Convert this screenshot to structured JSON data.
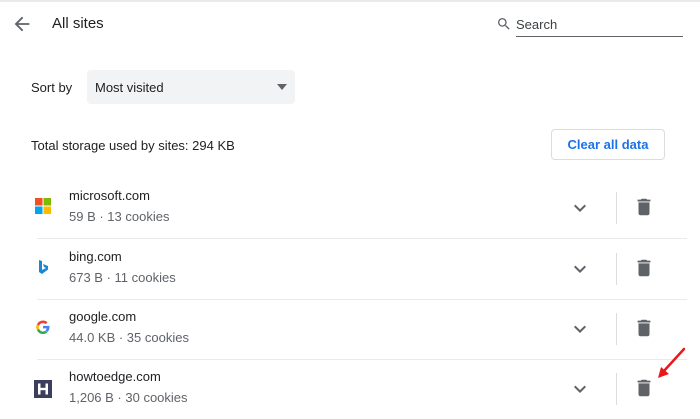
{
  "header": {
    "title": "All sites",
    "search_placeholder": "Search"
  },
  "sort": {
    "label": "Sort by",
    "selected": "Most visited"
  },
  "storage": {
    "text": "Total storage used by sites: 294 KB",
    "clear_label": "Clear all data"
  },
  "sites": [
    {
      "name": "microsoft.com",
      "details": "59 B · 13 cookies",
      "icon": "microsoft-logo-icon"
    },
    {
      "name": "bing.com",
      "details": "673 B · 11 cookies",
      "icon": "bing-logo-icon"
    },
    {
      "name": "google.com",
      "details": "44.0 KB · 35 cookies",
      "icon": "google-logo-icon"
    },
    {
      "name": "howtoedge.com",
      "details": "1,206 B · 30 cookies",
      "icon": "howtoedge-logo-icon"
    }
  ],
  "colors": {
    "accent": "#1a73e8",
    "annotation_arrow": "#e8191b"
  }
}
